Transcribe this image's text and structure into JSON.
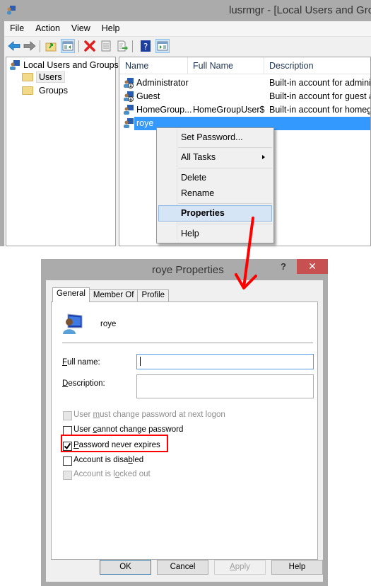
{
  "window": {
    "title": "lusrmgr - [Local Users and Groups (Local)\\Users]",
    "title_visible": "lusrmgr - [Local Users and Grou"
  },
  "menubar": [
    "File",
    "Action",
    "View",
    "Help"
  ],
  "toolbar": {
    "buttons": [
      "back-icon",
      "forward-icon",
      "up-folder-icon",
      "show-hide-console-tree-icon",
      "delete-icon",
      "properties-icon",
      "export-list-icon",
      "help-icon",
      "show-hide-action-pane-icon"
    ]
  },
  "tree": {
    "root": "Local Users and Groups",
    "children": [
      "Users",
      "Groups"
    ],
    "selected": "Users"
  },
  "list": {
    "columns": [
      "Name",
      "Full Name",
      "Description"
    ],
    "rows": [
      {
        "name": "Administrator",
        "full_name": "",
        "description": "Built-in account for administering the computer/domain"
      },
      {
        "name": "Guest",
        "full_name": "",
        "description": "Built-in account for guest access"
      },
      {
        "name": "HomeGroup...",
        "full_name": "HomeGroupUser$",
        "description": "Built-in account for homegroup access"
      },
      {
        "name": "roye",
        "full_name": "",
        "description": ""
      }
    ],
    "visible_descriptions": [
      "Built-in account for admini",
      "Built-in account for guest a",
      "Built-in account for homeg",
      ""
    ],
    "selected_row": "roye"
  },
  "context_menu": {
    "items": [
      "Set Password...",
      "All Tasks",
      "Delete",
      "Rename",
      "Properties",
      "Help"
    ],
    "highlighted": "Properties"
  },
  "dialog": {
    "title": "roye Properties",
    "help_glyph": "?",
    "close_glyph": "✕",
    "tabs": [
      "General",
      "Member Of",
      "Profile"
    ],
    "active_tab": "General",
    "username": "roye",
    "full_name_label_u": "F",
    "full_name_label_rest": "ull name:",
    "full_name_value": "",
    "description_label_u": "D",
    "description_label_rest": "escription:",
    "description_value": "",
    "checkboxes": [
      {
        "pre": "User ",
        "u": "m",
        "post": "ust change password at next logon",
        "checked": false,
        "disabled": true
      },
      {
        "pre": "User ",
        "u": "c",
        "post": "annot change password",
        "checked": false,
        "disabled": false
      },
      {
        "pre": "",
        "u": "P",
        "post": "assword never expires",
        "checked": true,
        "disabled": false
      },
      {
        "pre": "Account is disa",
        "u": "b",
        "post": "led",
        "checked": false,
        "disabled": false
      },
      {
        "pre": "Account is l",
        "u": "o",
        "post": "cked out",
        "checked": false,
        "disabled": true
      }
    ],
    "buttons": {
      "ok": "OK",
      "cancel": "Cancel",
      "apply_u": "A",
      "apply_rest": "pply",
      "help": "Help"
    }
  },
  "annotation": {
    "highlight_color": "#ff0000",
    "highlighted_option": "Password never expires"
  },
  "colors": {
    "selection": "#3399ff",
    "menu_hover": "#d5e5f5",
    "close_button": "#c75050",
    "frame": "#ababab"
  }
}
